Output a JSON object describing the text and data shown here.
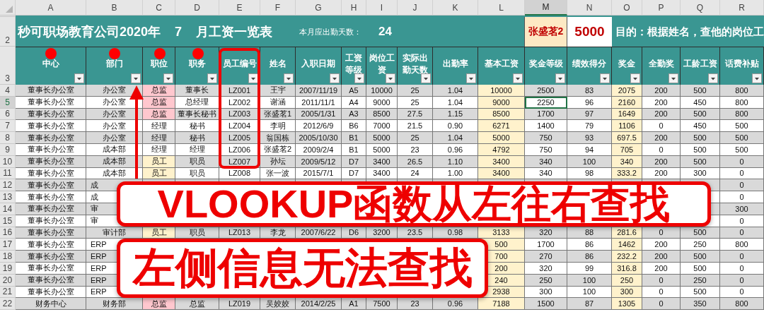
{
  "column_headers": [
    {
      "label": "A",
      "selected": false
    },
    {
      "label": "B",
      "selected": false
    },
    {
      "label": "C",
      "selected": false
    },
    {
      "label": "D",
      "selected": false
    },
    {
      "label": "E",
      "selected": false
    },
    {
      "label": "F",
      "selected": false
    },
    {
      "label": "G",
      "selected": false
    },
    {
      "label": "H",
      "selected": false
    },
    {
      "label": "I",
      "selected": false
    },
    {
      "label": "J",
      "selected": false
    },
    {
      "label": "K",
      "selected": false
    },
    {
      "label": "L",
      "selected": false
    },
    {
      "label": "M",
      "selected": true
    },
    {
      "label": "N",
      "selected": false
    },
    {
      "label": "O",
      "selected": false
    },
    {
      "label": "P",
      "selected": false
    },
    {
      "label": "Q",
      "selected": false
    },
    {
      "label": "R",
      "selected": false
    }
  ],
  "title_row": {
    "number": "2",
    "title": "秒可职场教育公司2020年",
    "month": "7",
    "suffix": "月工资一览表",
    "days_label": "本月应出勤天数：",
    "days": "24",
    "lookup_name": "张盛茗2",
    "lookup_result": "5000",
    "purpose": "目的：根据姓名，查他的岗位工"
  },
  "header_row": {
    "number": "3",
    "labels": [
      "中心",
      "部门",
      "职位",
      "职务",
      "员工编号",
      "姓名",
      "入职日期",
      "工资等级",
      "岗位工资",
      "实际出勤天数",
      "出勤率",
      "基本工资",
      "奖金等级",
      "绩效得分",
      "奖金",
      "全勤奖",
      "工龄工资",
      "话费补贴"
    ]
  },
  "rows": [
    {
      "number": "4",
      "selected": false,
      "color": "#ffc7ce",
      "cells": [
        "董事长办公室",
        "办公室",
        "总监",
        "董事长",
        "LZ001",
        "王宇",
        "2007/11/19",
        "A5",
        "10000",
        "25",
        "1.04",
        "10000",
        "2500",
        "83",
        "2075",
        "200",
        "500",
        "800"
      ]
    },
    {
      "number": "5",
      "selected": true,
      "color": "#ffc7ce",
      "cells": [
        "董事长办公室",
        "办公室",
        "总监",
        "总经理",
        "LZ002",
        "谢涵",
        "2011/11/1",
        "A4",
        "9000",
        "25",
        "1.04",
        "9000",
        "2250",
        "96",
        "2160",
        "200",
        "450",
        "800"
      ]
    },
    {
      "number": "6",
      "selected": false,
      "color": "#ffc7ce",
      "cells": [
        "董事长办公室",
        "办公室",
        "总监",
        "董事长秘书",
        "LZ003",
        "张盛茗1",
        "2005/1/31",
        "A3",
        "8500",
        "27.5",
        "1.15",
        "8500",
        "1700",
        "97",
        "1649",
        "200",
        "500",
        "800"
      ]
    },
    {
      "number": "7",
      "selected": false,
      "cells": [
        "董事长办公室",
        "办公室",
        "经理",
        "秘书",
        "LZ004",
        "李明",
        "2012/6/9",
        "B6",
        "7000",
        "21.5",
        "0.90",
        "6271",
        "1400",
        "79",
        "1106",
        "0",
        "450",
        "500"
      ]
    },
    {
      "number": "8",
      "selected": false,
      "cells": [
        "董事长办公室",
        "办公室",
        "经理",
        "秘书",
        "LZ005",
        "翁国栋",
        "2005/10/30",
        "B1",
        "5000",
        "25",
        "1.04",
        "5000",
        "750",
        "93",
        "697.5",
        "200",
        "500",
        "500"
      ]
    },
    {
      "number": "9",
      "selected": false,
      "cells": [
        "董事长办公室",
        "成本部",
        "经理",
        "经理",
        "LZ006",
        "张盛茗2",
        "2009/2/4",
        "B1",
        "5000",
        "23",
        "0.96",
        "4792",
        "750",
        "94",
        "705",
        "0",
        "500",
        "500"
      ]
    },
    {
      "number": "10",
      "selected": false,
      "color": "#fff2cc",
      "cells": [
        "董事长办公室",
        "成本部",
        "员工",
        "职员",
        "LZ007",
        "孙坛",
        "2009/5/12",
        "D7",
        "3400",
        "26.5",
        "1.10",
        "3400",
        "340",
        "100",
        "340",
        "200",
        "500",
        "0"
      ]
    },
    {
      "number": "11",
      "selected": false,
      "color": "#fff2cc",
      "cells": [
        "董事长办公室",
        "成本部",
        "员工",
        "职员",
        "LZ008",
        "张一波",
        "2015/7/1",
        "D7",
        "3400",
        "24",
        "1.00",
        "3400",
        "340",
        "98",
        "333.2",
        "200",
        "300",
        "0"
      ]
    },
    {
      "number": "12",
      "selected": false,
      "cells": [
        "董事长办公室",
        {
          "text": "成",
          "cut": true
        },
        null,
        null,
        null,
        null,
        null,
        null,
        null,
        null,
        null,
        null,
        null,
        null,
        null,
        null,
        null,
        "0"
      ]
    },
    {
      "number": "13",
      "selected": false,
      "cells": [
        "董事长办公室",
        {
          "text": "成",
          "cut": true
        },
        null,
        null,
        null,
        null,
        null,
        null,
        null,
        null,
        null,
        null,
        null,
        null,
        null,
        null,
        null,
        "0"
      ]
    },
    {
      "number": "14",
      "selected": false,
      "cells": [
        "董事长办公室",
        {
          "text": "审",
          "cut": true
        },
        null,
        null,
        null,
        null,
        null,
        null,
        null,
        null,
        null,
        null,
        null,
        null,
        null,
        null,
        null,
        "300"
      ]
    },
    {
      "number": "15",
      "selected": false,
      "cells": [
        "董事长办公室",
        {
          "text": "审",
          "cut": true
        },
        null,
        null,
        null,
        null,
        null,
        null,
        null,
        null,
        null,
        null,
        null,
        null,
        null,
        null,
        null,
        "0"
      ]
    },
    {
      "number": "16",
      "selected": false,
      "color": "#fff2cc",
      "cells": [
        "董事长办公室",
        "审计部",
        "员工",
        "职员",
        "LZ013",
        "李龙",
        "2007/6/22",
        "D6",
        "3200",
        "23.5",
        "0.98",
        "3133",
        "320",
        "88",
        "281.6",
        "0",
        "500",
        "0"
      ]
    },
    {
      "number": "17",
      "selected": false,
      "cells": [
        "董事长办公室",
        {
          "text": "ERP",
          "cut": true
        },
        null,
        null,
        null,
        null,
        null,
        null,
        null,
        null,
        null,
        "500",
        "1700",
        "86",
        "1462",
        "200",
        "250",
        "800"
      ]
    },
    {
      "number": "18",
      "selected": false,
      "cells": [
        "董事长办公室",
        {
          "text": "ERP",
          "cut": true
        },
        null,
        null,
        null,
        null,
        null,
        null,
        null,
        null,
        null,
        "700",
        "270",
        "86",
        "232.2",
        "200",
        "500",
        "0"
      ]
    },
    {
      "number": "19",
      "selected": false,
      "cells": [
        "董事长办公室",
        {
          "text": "ERP",
          "cut": true
        },
        null,
        null,
        null,
        null,
        null,
        null,
        null,
        null,
        null,
        "200",
        "320",
        "99",
        "316.8",
        "200",
        "500",
        "0"
      ]
    },
    {
      "number": "20",
      "selected": false,
      "cells": [
        "董事长办公室",
        {
          "text": "ERP",
          "cut": true
        },
        null,
        null,
        null,
        null,
        null,
        null,
        null,
        null,
        null,
        "240",
        "250",
        "100",
        "250",
        "0",
        "250",
        "0"
      ]
    },
    {
      "number": "21",
      "selected": false,
      "cells": [
        "董事长办公室",
        {
          "text": "ERP",
          "cut": true
        },
        null,
        null,
        null,
        null,
        null,
        null,
        null,
        null,
        null,
        "2938",
        "300",
        "100",
        "300",
        "0",
        "500",
        "0"
      ]
    },
    {
      "number": "22",
      "selected": false,
      "color": "#ffc7ce",
      "cells": [
        "财务中心",
        "财务部",
        "总监",
        "总监",
        "LZ019",
        "吴姣姣",
        "2014/2/25",
        "A1",
        "7500",
        "23",
        "0.96",
        "7188",
        "1500",
        "87",
        "1305",
        "0",
        "350",
        "800"
      ]
    }
  ],
  "callouts": [
    "VLOOKUP函数从左往右查找",
    "左侧信息无法查找"
  ]
}
